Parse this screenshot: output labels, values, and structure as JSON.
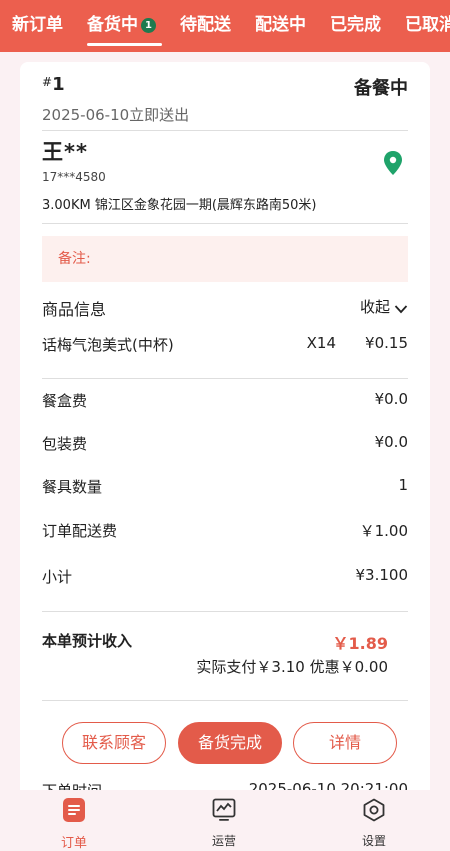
{
  "tabs": [
    {
      "label": "新订单"
    },
    {
      "label": "备货中",
      "badge": "1"
    },
    {
      "label": "待配送"
    },
    {
      "label": "配送中"
    },
    {
      "label": "已完成"
    },
    {
      "label": "已取消"
    }
  ],
  "order": {
    "hash": "#",
    "number": "1",
    "status": "备餐中",
    "deliver_time": "2025-06-10立即送出",
    "customer_name": "王**",
    "customer_phone": "17***4580",
    "address": "3.00KM  锦江区金象花园一期(晨辉东路南50米)",
    "remark_label": "备注:",
    "goods_title": "商品信息",
    "collapse_label": "收起",
    "items": [
      {
        "name": "话梅气泡美式(中杯)",
        "qty": "X14",
        "price": "¥0.15"
      }
    ],
    "fees": [
      {
        "label": "餐盒费",
        "value": "¥0.0"
      },
      {
        "label": "包装费",
        "value": "¥0.0"
      },
      {
        "label": "餐具数量",
        "value": "1"
      },
      {
        "label": "订单配送费",
        "value": "￥1.00"
      },
      {
        "label": "小计",
        "value": "¥3.100"
      }
    ],
    "income_label": "本单预计收入",
    "income_value": "￥1.89",
    "actual_pay": "实际支付￥3.10 优惠￥0.00",
    "order_time_label": "下单时间",
    "order_time_value": "2025-06-10 20:21:00"
  },
  "actions": {
    "contact": "联系顾客",
    "complete": "备货完成",
    "details": "详情"
  },
  "bottom_nav": [
    {
      "label": "订单",
      "icon": "order-list-icon"
    },
    {
      "label": "运营",
      "icon": "chart-monitor-icon"
    },
    {
      "label": "设置",
      "icon": "settings-hexagon-icon"
    }
  ],
  "colors": {
    "accent": "#ec5f4e",
    "accent_text": "#e35b4a",
    "badge": "#1e7a4e",
    "pin": "#1fa36a",
    "remark_bg": "#fdf0ee"
  }
}
